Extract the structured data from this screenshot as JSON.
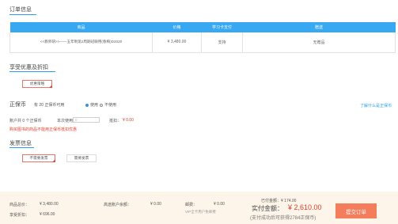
{
  "order_section": {
    "title": "订单信息",
    "columns": [
      "商品",
      "价格",
      "学习卡支付",
      "赠送"
    ],
    "rows": [
      {
        "product": "<<教师研>>——五年制第2周期班联用(春梅)D2020",
        "price": "¥ 3,480.00",
        "card_payment": "支持",
        "gift": "无赠品"
      }
    ]
  },
  "discount_section": {
    "title": "享受优惠及折扣",
    "button_label": "优惠策略"
  },
  "coin_section": {
    "title": "正保币",
    "available_text": "有 20 正保币可用",
    "option_use": "使用",
    "option_not_use": "不使用",
    "help_link": "了解什么是正保币",
    "account_text": "账户共 0 个正保币",
    "this_use_label": "本次使用：",
    "this_use_value": "0",
    "deduct_label": "抵扣：",
    "deduct_value": "¥ 0.00",
    "warning": "购买图书的商品不能用正保币抵扣优惠"
  },
  "invoice_section": {
    "title": "发票信息",
    "option_no_invoice": "不需要发票",
    "option_need_invoice": "需要发票"
  },
  "footer": {
    "goods_total_label": "商品总价：",
    "goods_total_value": "¥ 3,480.00",
    "discount_label": "享受折扣：",
    "discount_value": "¥ 696.00",
    "balance_label": "高途账户余额：",
    "balance_value": "¥ 0.00",
    "postage_label": "邮费：",
    "postage_value": "¥ 0.00",
    "postage_note": "VIP全卡用户免邮费",
    "paid_text": "已付金额：¥ 174.00",
    "actual_label": "实付金额：",
    "actual_value": "¥ 2,610.00",
    "reward_note": "(支付成功后可获得2784正保币)",
    "submit_label": "提交订单"
  }
}
